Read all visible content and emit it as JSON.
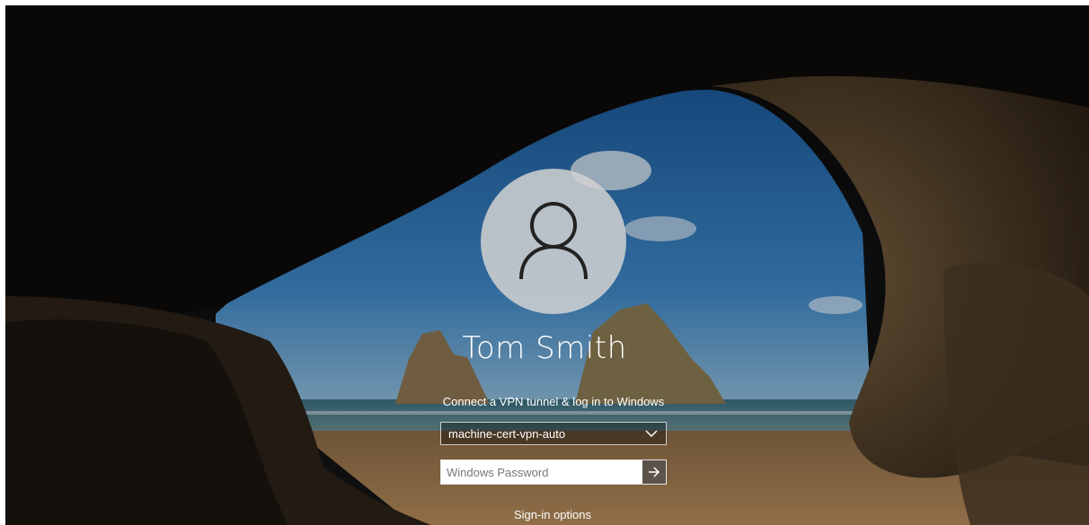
{
  "user": {
    "name": "Tom Smith",
    "avatar_icon": "user-silhouette-icon"
  },
  "login": {
    "connect_label": "Connect a VPN tunnel & log in to Windows",
    "vpn_selected": "machine-cert-vpn-auto",
    "password_placeholder": "Windows Password",
    "submit_icon": "arrow-right-icon",
    "dropdown_icon": "chevron-down-icon"
  },
  "footer": {
    "signin_options": "Sign-in options"
  },
  "colors": {
    "sky": "#2a6fae",
    "rock": "#5a4630",
    "sand": "#a07a4e",
    "avatar_bg": "#d2d2d2"
  }
}
